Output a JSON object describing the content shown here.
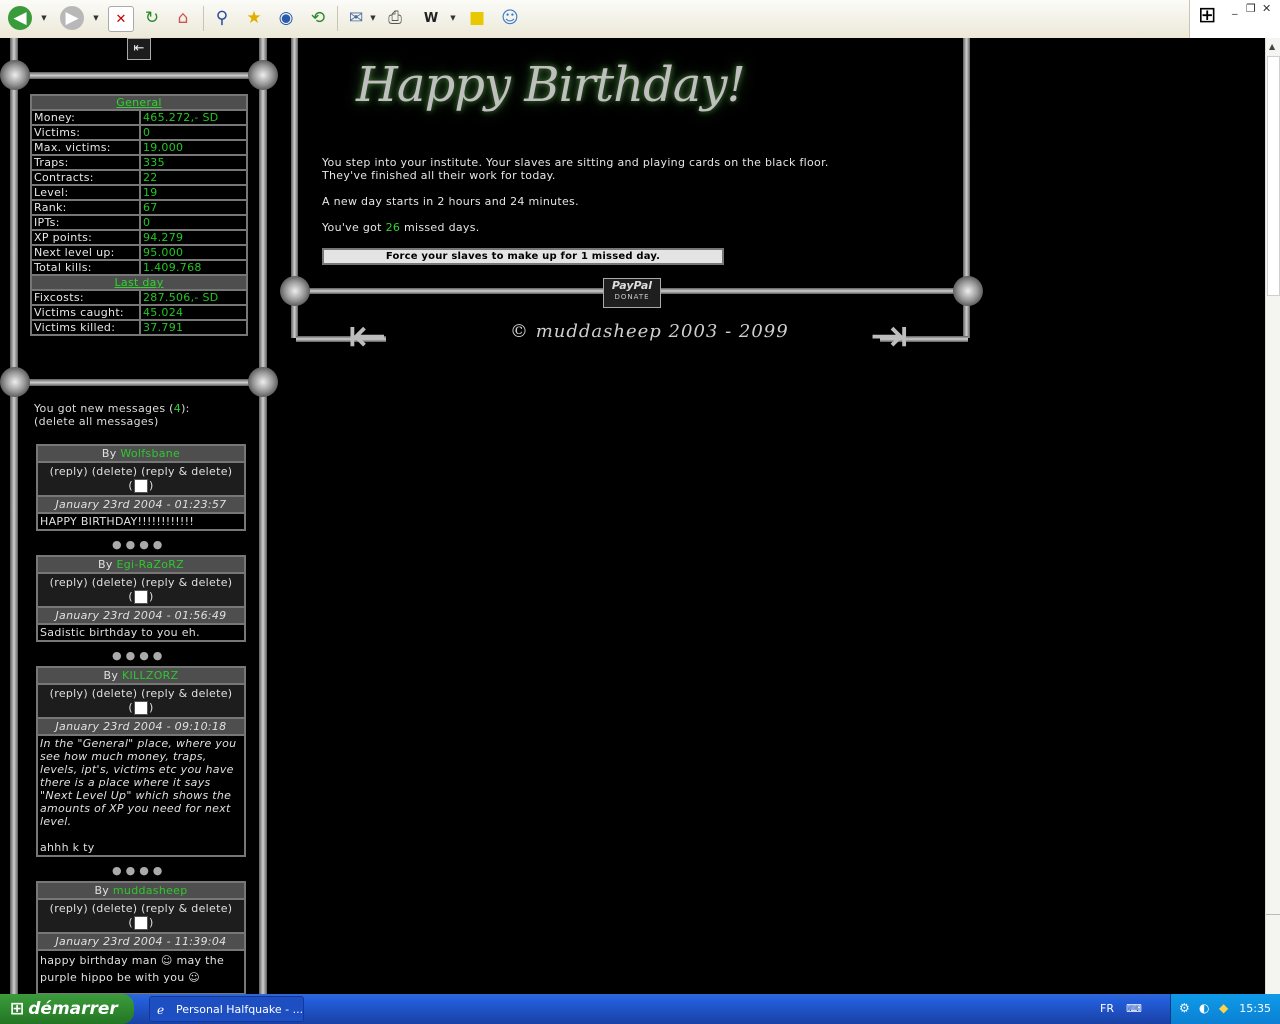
{
  "window_controls": {
    "minimize": "_",
    "restore": "❐",
    "close": "✕"
  },
  "toolbar": {
    "back_label": "Back",
    "forward_label": "Forward",
    "icons": [
      "back-icon",
      "forward-icon",
      "stop-icon",
      "refresh-icon",
      "home-icon",
      "search-icon",
      "favorites-icon",
      "media-icon",
      "history-icon",
      "mail-icon",
      "print-icon",
      "edit-icon",
      "discuss-icon",
      "messenger-icon"
    ]
  },
  "sidebar": {
    "general_header": "General",
    "stats": [
      {
        "label": "Money:",
        "value": "465.272,- SD"
      },
      {
        "label": "Victims:",
        "value": "0"
      },
      {
        "label": "Max. victims:",
        "value": "19.000"
      },
      {
        "label": "Traps:",
        "value": "335"
      },
      {
        "label": "Contracts:",
        "value": "22"
      },
      {
        "label": "Level:",
        "value": "19"
      },
      {
        "label": "Rank:",
        "value": "67"
      },
      {
        "label": "IPTs:",
        "value": "0"
      },
      {
        "label": "XP points:",
        "value": "94.279"
      },
      {
        "label": "Next level up:",
        "value": "95.000"
      },
      {
        "label": "Total kills:",
        "value": "1.409.768"
      }
    ],
    "last_day_header": "Last day",
    "last_day": [
      {
        "label": "Fixcosts:",
        "value": "287.506,- SD"
      },
      {
        "label": "Victims caught:",
        "value": "45.024"
      },
      {
        "label": "Victims killed:",
        "value": "37.791"
      }
    ],
    "messages_intro_pre": "You got new messages (",
    "messages_count": "4",
    "messages_intro_post": "):",
    "delete_all": "(delete all messages)",
    "by_label": "By",
    "actions": "(reply) (delete) (reply & delete)",
    "messages": [
      {
        "from": "Wolfsbane",
        "date": "January 23rd 2004 - 01:23:57",
        "body": "HAPPY BIRTHDAY!!!!!!!!!!!!"
      },
      {
        "from": "Egi-RaZoRZ",
        "date": "January 23rd 2004 - 01:56:49",
        "body": "Sadistic birthday to you eh."
      },
      {
        "from": "KILLZORZ",
        "date": "January 23rd 2004 - 09:10:18",
        "body": "In the \"General\" place, where you see how much money, traps, levels, ipt's, victims etc you have there is a place where it says \"Next Level Up\" which shows the amounts of XP you need for next level.",
        "body2": "ahhh k ty"
      },
      {
        "from": "muddasheep",
        "date": "January 23rd 2004 - 11:39:04",
        "body": "happy birthday man ☺ may the purple hippo be with you ☺"
      }
    ],
    "separator": "●●●●"
  },
  "main": {
    "banner": "Happy Birthday!",
    "line1": "You step into your institute. Your slaves are sitting and playing cards on the black floor.",
    "line2": "They've finished all their work for today.",
    "new_day": "A new day starts in 2 hours and 24 minutes.",
    "missed_pre": "You've got ",
    "missed_count": "26",
    "missed_post": " missed days.",
    "force_button": "Force your slaves to make up for 1 missed day.",
    "paypal_top": "PayPal",
    "paypal_bottom": "DONATE",
    "copyright": "© muddasheep 2003 - 2099"
  },
  "taskbar": {
    "start": "démarrer",
    "task_title": "Personal Halfquake - ...",
    "lang": "FR",
    "clock": "15:35"
  }
}
